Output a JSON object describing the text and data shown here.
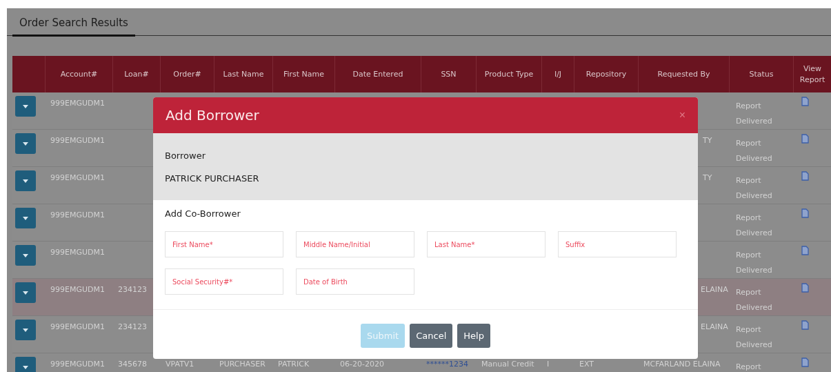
{
  "tab": {
    "label": "Order Search Results",
    "selected": true
  },
  "table": {
    "columns": [
      "Account#",
      "Loan#",
      "Order#",
      "Last Name",
      "First Name",
      "Date Entered",
      "SSN",
      "Product Type",
      "I/J",
      "Repository",
      "Requested By",
      "Status",
      "View Report"
    ],
    "rows": [
      {
        "selected": false,
        "account": "999EMGUDM1",
        "status": "Report Delivered"
      },
      {
        "selected": false,
        "account": "999EMGUDM1",
        "requested_by": "TY",
        "status": "Report Delivered"
      },
      {
        "selected": false,
        "account": "999EMGUDM1",
        "requested_by": "TY",
        "status": "Report Delivered"
      },
      {
        "selected": false,
        "account": "999EMGUDM1",
        "status": "Report Delivered"
      },
      {
        "selected": false,
        "account": "999EMGUDM1",
        "status": "Report Delivered"
      },
      {
        "selected": true,
        "account": "999EMGUDM1",
        "loan": "234123",
        "requested_by": "ELAINA",
        "status": "Report Delivered"
      },
      {
        "selected": false,
        "account": "999EMGUDM1",
        "loan": "234123",
        "requested_by": "ELAINA",
        "status": "Report Delivered"
      },
      {
        "selected": false,
        "account": "999EMGUDM1",
        "loan": "345678",
        "order": "VPATV1",
        "last_name": "PURCHASER",
        "first_name": "PATRICK",
        "date_entered": "06-20-2020",
        "ssn": "******1234",
        "product_type": "Manual Credit",
        "ij": "I",
        "repository": "EXT",
        "requested_by": "MCFARLAND ELAINA",
        "status": "Report"
      }
    ]
  },
  "dialog": {
    "title": "Add Borrower",
    "close": "×",
    "borrower_label": "Borrower",
    "borrower_name": "PATRICK PURCHASER",
    "section_title": "Add Co-Borrower",
    "fields": [
      [
        {
          "placeholder": "First Name*"
        },
        {
          "placeholder": "Middle Name/Initial"
        },
        {
          "placeholder": "Last Name*"
        },
        {
          "placeholder": "Suffix"
        }
      ],
      [
        {
          "placeholder": "Social Security#*"
        },
        {
          "placeholder": "Date of Birth"
        }
      ]
    ],
    "buttons": [
      {
        "label": "Submit",
        "kind": "primary",
        "disabled": true
      },
      {
        "label": "Cancel",
        "kind": "secondary",
        "disabled": false
      },
      {
        "label": "Help",
        "kind": "secondary",
        "disabled": false
      }
    ]
  }
}
